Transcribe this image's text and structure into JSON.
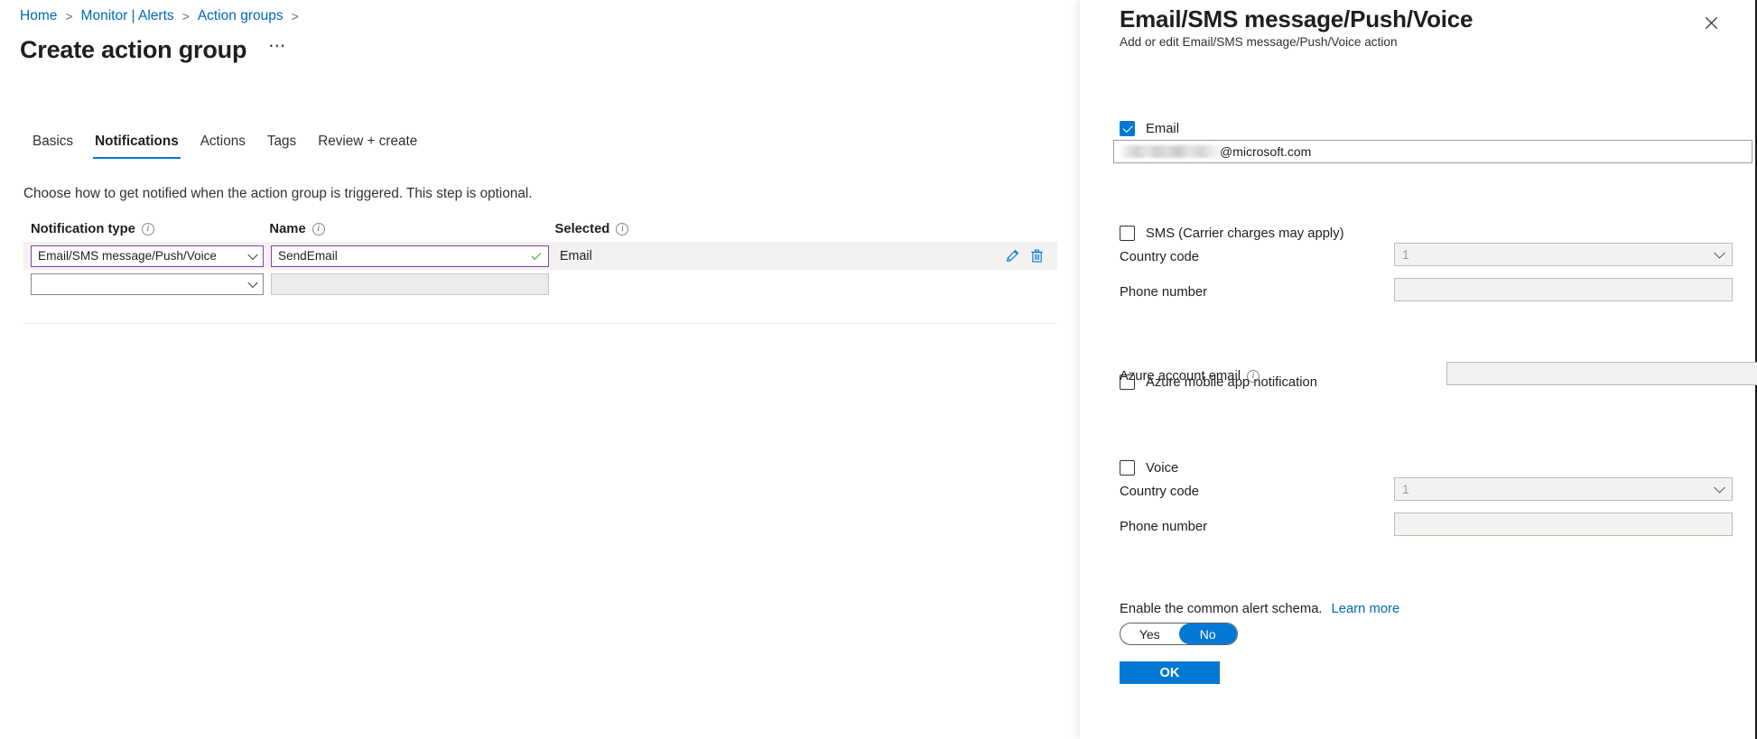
{
  "breadcrumb": {
    "items": [
      {
        "label": "Home"
      },
      {
        "label": "Monitor | Alerts"
      },
      {
        "label": "Action groups"
      }
    ],
    "separator": ">"
  },
  "page": {
    "title": "Create action group",
    "more_label": "⋯"
  },
  "tabs": [
    {
      "label": "Basics",
      "selected": false
    },
    {
      "label": "Notifications",
      "selected": true
    },
    {
      "label": "Actions",
      "selected": false
    },
    {
      "label": "Tags",
      "selected": false
    },
    {
      "label": "Review + create",
      "selected": false
    }
  ],
  "step_description": "Choose how to get notified when the action group is triggered. This step is optional.",
  "table": {
    "headers": {
      "notification_type": "Notification type",
      "name": "Name",
      "selected": "Selected"
    },
    "rows": [
      {
        "type_value": "Email/SMS message/Push/Voice",
        "name_value": "SendEmail",
        "name_valid": true,
        "selected_value": "Email",
        "has_actions": true,
        "edit_label": "Edit",
        "delete_label": "Delete"
      },
      {
        "type_value": "",
        "name_value": "",
        "name_valid": false,
        "selected_value": "",
        "has_actions": false
      }
    ]
  },
  "flyout": {
    "title": "Email/SMS message/Push/Voice",
    "subtitle": "Add or edit Email/SMS message/Push/Voice action",
    "close_label": "✕",
    "email": {
      "checkbox_label": "Email",
      "checked": true,
      "field_label": "Email",
      "required_mark": "*",
      "value_suffix": "@microsoft.com"
    },
    "sms": {
      "checkbox_label": "SMS (Carrier charges may apply)",
      "checked": false,
      "country_code_label": "Country code",
      "country_code_value": "1",
      "phone_label": "Phone number",
      "phone_value": ""
    },
    "mobile_app": {
      "checkbox_label": "Azure mobile app notification",
      "checked": false,
      "account_email_label": "Azure account email",
      "account_email_value": ""
    },
    "voice": {
      "checkbox_label": "Voice",
      "checked": false,
      "country_code_label": "Country code",
      "country_code_value": "1",
      "phone_label": "Phone number",
      "phone_value": ""
    },
    "schema": {
      "text": "Enable the common alert schema.",
      "learn_more": "Learn more",
      "options": [
        "Yes",
        "No"
      ],
      "selected": "No"
    },
    "ok_label": "OK"
  },
  "colors": {
    "accent_blue": "#0078d4",
    "link_blue": "#0067b8",
    "validation_purple": "#8c3dae",
    "success_green": "#3e9c1f",
    "required_red": "#a4262c"
  }
}
